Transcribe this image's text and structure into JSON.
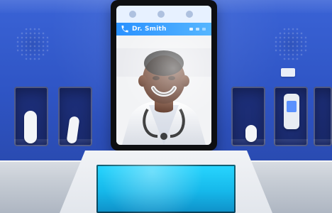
{
  "scene": {
    "tablet": {
      "header_title": "Dr. Smith"
    }
  },
  "icons": {
    "call": "call-icon",
    "speaker_left": "speaker-left-icon",
    "speaker_right": "speaker-right-icon"
  }
}
